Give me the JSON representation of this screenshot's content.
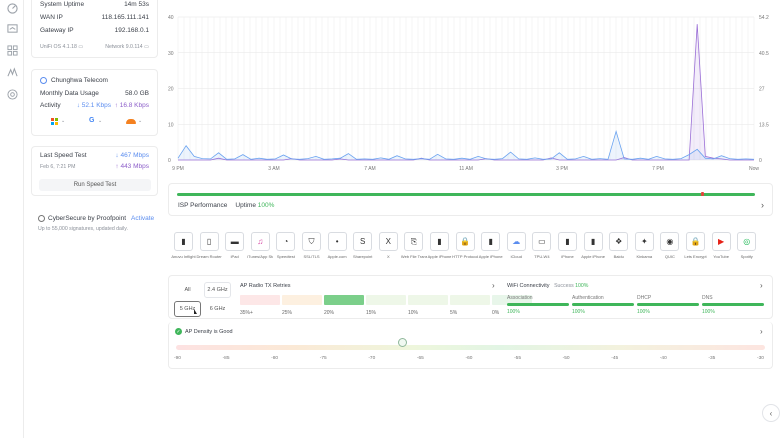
{
  "system": {
    "uptime_label": "System Uptime",
    "uptime_value": "14m 53s",
    "wan_ip_label": "WAN IP",
    "wan_ip_value": "118.165.111.141",
    "gateway_ip_label": "Gateway IP",
    "gateway_ip_value": "192.168.0.1",
    "os_version": "UniFi OS 4.1.18",
    "network_version": "Network 9.0.114"
  },
  "isp": {
    "name": "Chunghwa Telecom",
    "monthly_label": "Monthly Data Usage",
    "monthly_value": "58.0 GB",
    "activity_label": "Activity",
    "download": "52.1 Kbps",
    "upload": "16.8 Kbps"
  },
  "speedtest": {
    "label": "Last Speed Test",
    "date": "Feb 6, 7:21 PM",
    "download": "467 Mbps",
    "upload": "443 Mbps",
    "run_label": "Run Speed Test"
  },
  "cybersecure": {
    "title": "CyberSecure by Proofpoint",
    "activate": "Activate",
    "subtitle": "Up to 55,000 signatures, updated daily."
  },
  "chart_data": {
    "type": "line",
    "x": [
      "9 PM",
      "3 AM",
      "7 AM",
      "11 AM",
      "3 PM",
      "7 PM",
      "Now"
    ],
    "left_axis": [
      0,
      10,
      20,
      30,
      40
    ],
    "right_axis": [
      0,
      13.5,
      27,
      40.5,
      54.2
    ],
    "ylim": [
      0,
      40
    ],
    "series": [
      {
        "color": "#9b6fd6",
        "values": [
          0,
          0,
          0,
          0,
          0,
          0.5,
          0,
          0,
          0,
          0,
          0,
          0,
          0,
          0,
          0.4,
          0,
          0,
          0,
          0,
          0,
          0.3,
          0,
          0,
          0,
          0,
          0,
          0,
          0,
          0,
          0,
          0.5,
          0,
          0,
          0,
          0,
          0,
          0,
          0,
          0.4,
          0,
          0,
          0,
          0,
          0,
          0,
          0,
          0.6,
          0,
          0,
          0,
          0,
          0,
          0,
          0,
          0,
          0.7,
          0,
          0,
          0,
          0,
          0,
          0,
          0,
          0,
          38,
          1,
          0.5,
          0.3,
          0,
          0,
          0,
          0
        ]
      },
      {
        "color": "#6aa3f0",
        "values": [
          0.5,
          4,
          1,
          0.4,
          0.3,
          2,
          0.2,
          0.3,
          1.5,
          0.2,
          0.5,
          0.2,
          0.3,
          1.4,
          0.3,
          0.2,
          0.4,
          1,
          0.2,
          0.3,
          0.5,
          1.8,
          0.2,
          0.3,
          0.2,
          0.6,
          0.2,
          1.2,
          0.3,
          0.2,
          0.4,
          0.2,
          1.6,
          0.3,
          0.2,
          0.5,
          0.2,
          1,
          0.3,
          0.2,
          0.4,
          2.2,
          0.3,
          0.2,
          0.6,
          0.2,
          0.3,
          2,
          0.2,
          0.3,
          1,
          0.2,
          0.4,
          0.2,
          8,
          0.3,
          0.2,
          0.5,
          0.2,
          1,
          0.3,
          0.2,
          0.4,
          1.5,
          3,
          0.5,
          0.3,
          1.2,
          0.4,
          0.2,
          0.3,
          0.2
        ]
      }
    ]
  },
  "isp_performance": {
    "label": "ISP Performance",
    "uptime_label": "Uptime",
    "uptime_value": "100%"
  },
  "apps": [
    {
      "label": "Anuvu Inflight",
      "icon": "phone-icon"
    },
    {
      "label": "Dream Router",
      "icon": "router-icon"
    },
    {
      "label": "iPad",
      "icon": "tablet-icon"
    },
    {
      "label": "iTunes/App Store",
      "icon": "music-icon"
    },
    {
      "label": "Speedtest",
      "icon": "speed-icon"
    },
    {
      "label": "SSL/TLS",
      "icon": "shield-icon"
    },
    {
      "label": "Apple.com",
      "icon": "apple-icon"
    },
    {
      "label": "Sharepoint",
      "icon": "sharepoint-icon"
    },
    {
      "label": "X",
      "icon": "x-icon"
    },
    {
      "label": "Web File Transfer",
      "icon": "file-icon"
    },
    {
      "label": "Apple iPhone",
      "icon": "phone-icon"
    },
    {
      "label": "HTTP Protocol",
      "icon": "lock-icon"
    },
    {
      "label": "Apple iPhone",
      "icon": "phone-icon"
    },
    {
      "label": "iCloud",
      "icon": "cloud-icon"
    },
    {
      "label": "TPU-W4",
      "icon": "device-icon"
    },
    {
      "label": "iPhone",
      "icon": "phone-icon"
    },
    {
      "label": "Apple iPhone",
      "icon": "phone-icon"
    },
    {
      "label": "Baidu",
      "icon": "paw-icon"
    },
    {
      "label": "Kinkama",
      "icon": "star-icon"
    },
    {
      "label": "QUIC",
      "icon": "eye-icon"
    },
    {
      "label": "Lets Encrypt",
      "icon": "lock-icon"
    },
    {
      "label": "YouTube",
      "icon": "play-icon"
    },
    {
      "label": "Spotify",
      "icon": "spotify-icon"
    }
  ],
  "bands": {
    "all": "All",
    "g24": "2.4 GHz",
    "g5": "5 GHz",
    "g6": "6 GHz"
  },
  "retries": {
    "title": "AP Radio TX Retries",
    "labels": [
      "35%+",
      "25%",
      "20%",
      "15%",
      "10%",
      "5%",
      "0%"
    ],
    "highlighted": "20%"
  },
  "wifi": {
    "title": "WiFi Connectivity",
    "success_label": "Success",
    "success_value": "100%",
    "stages": [
      {
        "label": "Association",
        "value": "100%"
      },
      {
        "label": "Authentication",
        "value": "100%"
      },
      {
        "label": "DHCP",
        "value": "100%"
      },
      {
        "label": "DNS",
        "value": "100%"
      }
    ]
  },
  "density": {
    "label": "AP Density is Good",
    "ticks": [
      "-90",
      "-85",
      "-80",
      "-75",
      "-70",
      "-65",
      "-60",
      "-55",
      "-50",
      "-45",
      "-40",
      "-35",
      "-30"
    ],
    "marker_dbm": -67
  },
  "colors": {
    "accent": "#5b8def",
    "green": "#3fb65a",
    "purple": "#8c5ec9"
  }
}
